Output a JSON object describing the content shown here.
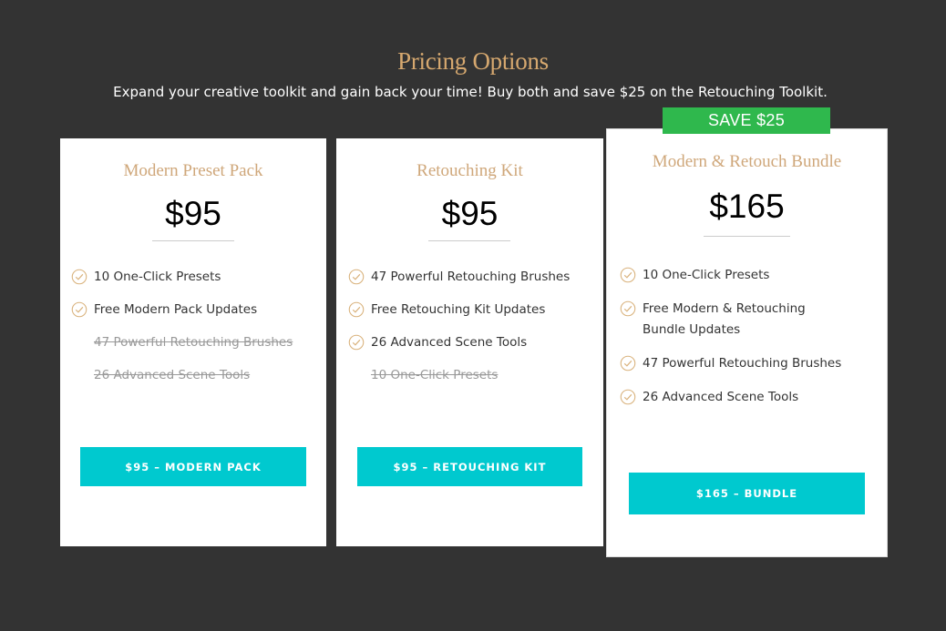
{
  "header": {
    "title": "Pricing Options",
    "subtitle": "Expand your creative toolkit and gain back your time! Buy both and save $25 on the Retouching Toolkit."
  },
  "colors": {
    "background": "#333333",
    "title_gold": "#d6a86f",
    "button_teal": "#00c9cf",
    "badge_green": "#2fb84d",
    "check_gold": "#d9b27c"
  },
  "cards": [
    {
      "title": "Modern Preset Pack",
      "price": "$95",
      "features": [
        {
          "text": "10 One-Click Presets",
          "included": true
        },
        {
          "text": "Free Modern Pack Updates",
          "included": true
        },
        {
          "text": "47 Powerful Retouching Brushes",
          "included": false
        },
        {
          "text": "26 Advanced Scene Tools",
          "included": false
        }
      ],
      "button": "$95 – MODERN PACK"
    },
    {
      "title": "Retouching Kit",
      "price": "$95",
      "features": [
        {
          "text": "47 Powerful Retouching Brushes",
          "included": true
        },
        {
          "text": "Free Retouching Kit Updates",
          "included": true
        },
        {
          "text": "26 Advanced Scene Tools",
          "included": true
        },
        {
          "text": "10 One-Click Presets",
          "included": false
        }
      ],
      "button": "$95 – RETOUCHING KIT"
    },
    {
      "badge": "SAVE $25",
      "title": "Modern & Retouch Bundle",
      "price": "$165",
      "features": [
        {
          "text": "10 One-Click Presets",
          "included": true
        },
        {
          "text": "Free Modern & Retouching Bundle Updates",
          "included": true
        },
        {
          "text": "47 Powerful Retouching Brushes",
          "included": true
        },
        {
          "text": "26 Advanced Scene Tools",
          "included": true
        }
      ],
      "button": "$165 – BUNDLE"
    }
  ]
}
